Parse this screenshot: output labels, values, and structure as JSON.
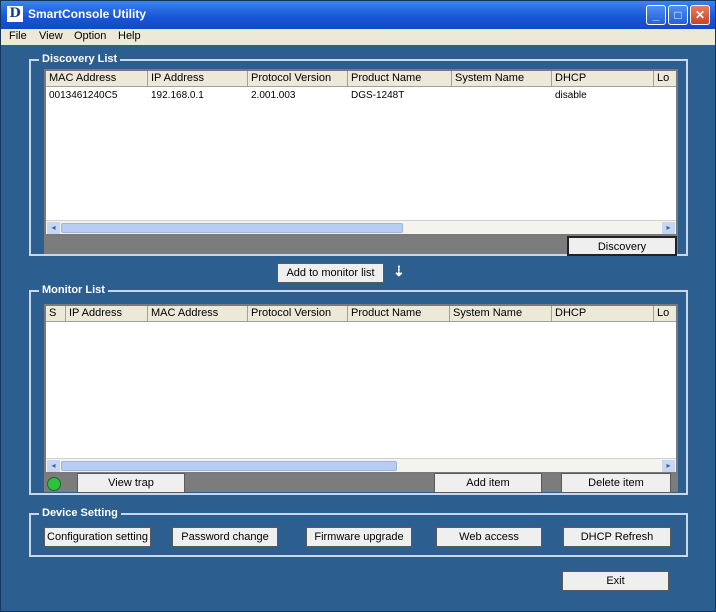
{
  "window": {
    "title": "SmartConsole Utility",
    "icon": "D"
  },
  "titlebar_buttons": {
    "minimize": "_",
    "maximize": "□",
    "close": "✕"
  },
  "menu": [
    "File",
    "View",
    "Option",
    "Help"
  ],
  "discovery": {
    "title": "Discovery List",
    "columns": [
      "MAC Address",
      "IP Address",
      "Protocol Version",
      "Product Name",
      "System Name",
      "DHCP",
      "Lo"
    ],
    "rows": [
      [
        "0013461240C5",
        "192.168.0.1",
        "2.001.003",
        "DGS-1248T",
        "",
        "disable",
        ""
      ]
    ],
    "discovery_button": "Discovery"
  },
  "add_to_monitor": {
    "label": "Add to monitor list",
    "arrow": "⇣"
  },
  "monitor": {
    "title": "Monitor List",
    "columns": [
      "S",
      "IP Address",
      "MAC Address",
      "Protocol Version",
      "Product Name",
      "System Name",
      "DHCP",
      "Lo"
    ],
    "view_trap": "View trap",
    "add_item": "Add item",
    "delete_item": "Delete item",
    "status_color": "#30c040"
  },
  "device_setting": {
    "title": "Device Setting",
    "buttons": [
      "Configuration setting",
      "Password change",
      "Firmware upgrade",
      "Web access",
      "DHCP Refresh"
    ]
  },
  "exit_label": "Exit",
  "scroll_arrows": {
    "left": "◂",
    "right": "▸"
  }
}
